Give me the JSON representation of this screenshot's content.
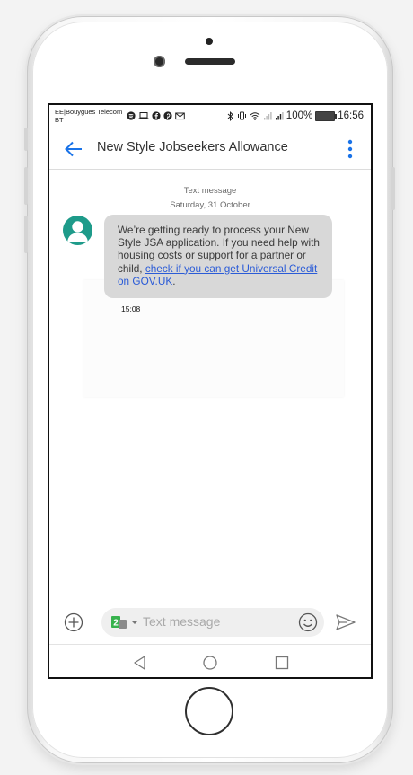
{
  "status_bar": {
    "carrier": "EE|Bouygues Telecom BT",
    "battery_percent": "100%",
    "time": "16:56"
  },
  "header": {
    "title": "New Style Jobseekers Allowance"
  },
  "conversation": {
    "channel_label": "Text message",
    "date_label": "Saturday, 31 October",
    "message": {
      "text_before_link": "We’re getting ready to process your New Style JSA application. If you need help with housing costs or support for a partner or child, ",
      "link_text": "check if you can get Universal Credit on GOV.UK",
      "text_after_link": ".",
      "time": "15:08"
    }
  },
  "composer": {
    "sim_slot": "2",
    "placeholder": "Text message"
  },
  "colors": {
    "accent": "#1a73e8",
    "avatar": "#1e9b8a",
    "bubble": "#d8d8d8",
    "link": "#2a5bd7"
  },
  "icons": [
    "back-arrow-icon",
    "more-vert-icon",
    "person-icon",
    "add-circle-icon",
    "sim-card-icon",
    "emoji-icon",
    "send-icon",
    "nav-back-icon",
    "nav-home-icon",
    "nav-recents-icon"
  ]
}
